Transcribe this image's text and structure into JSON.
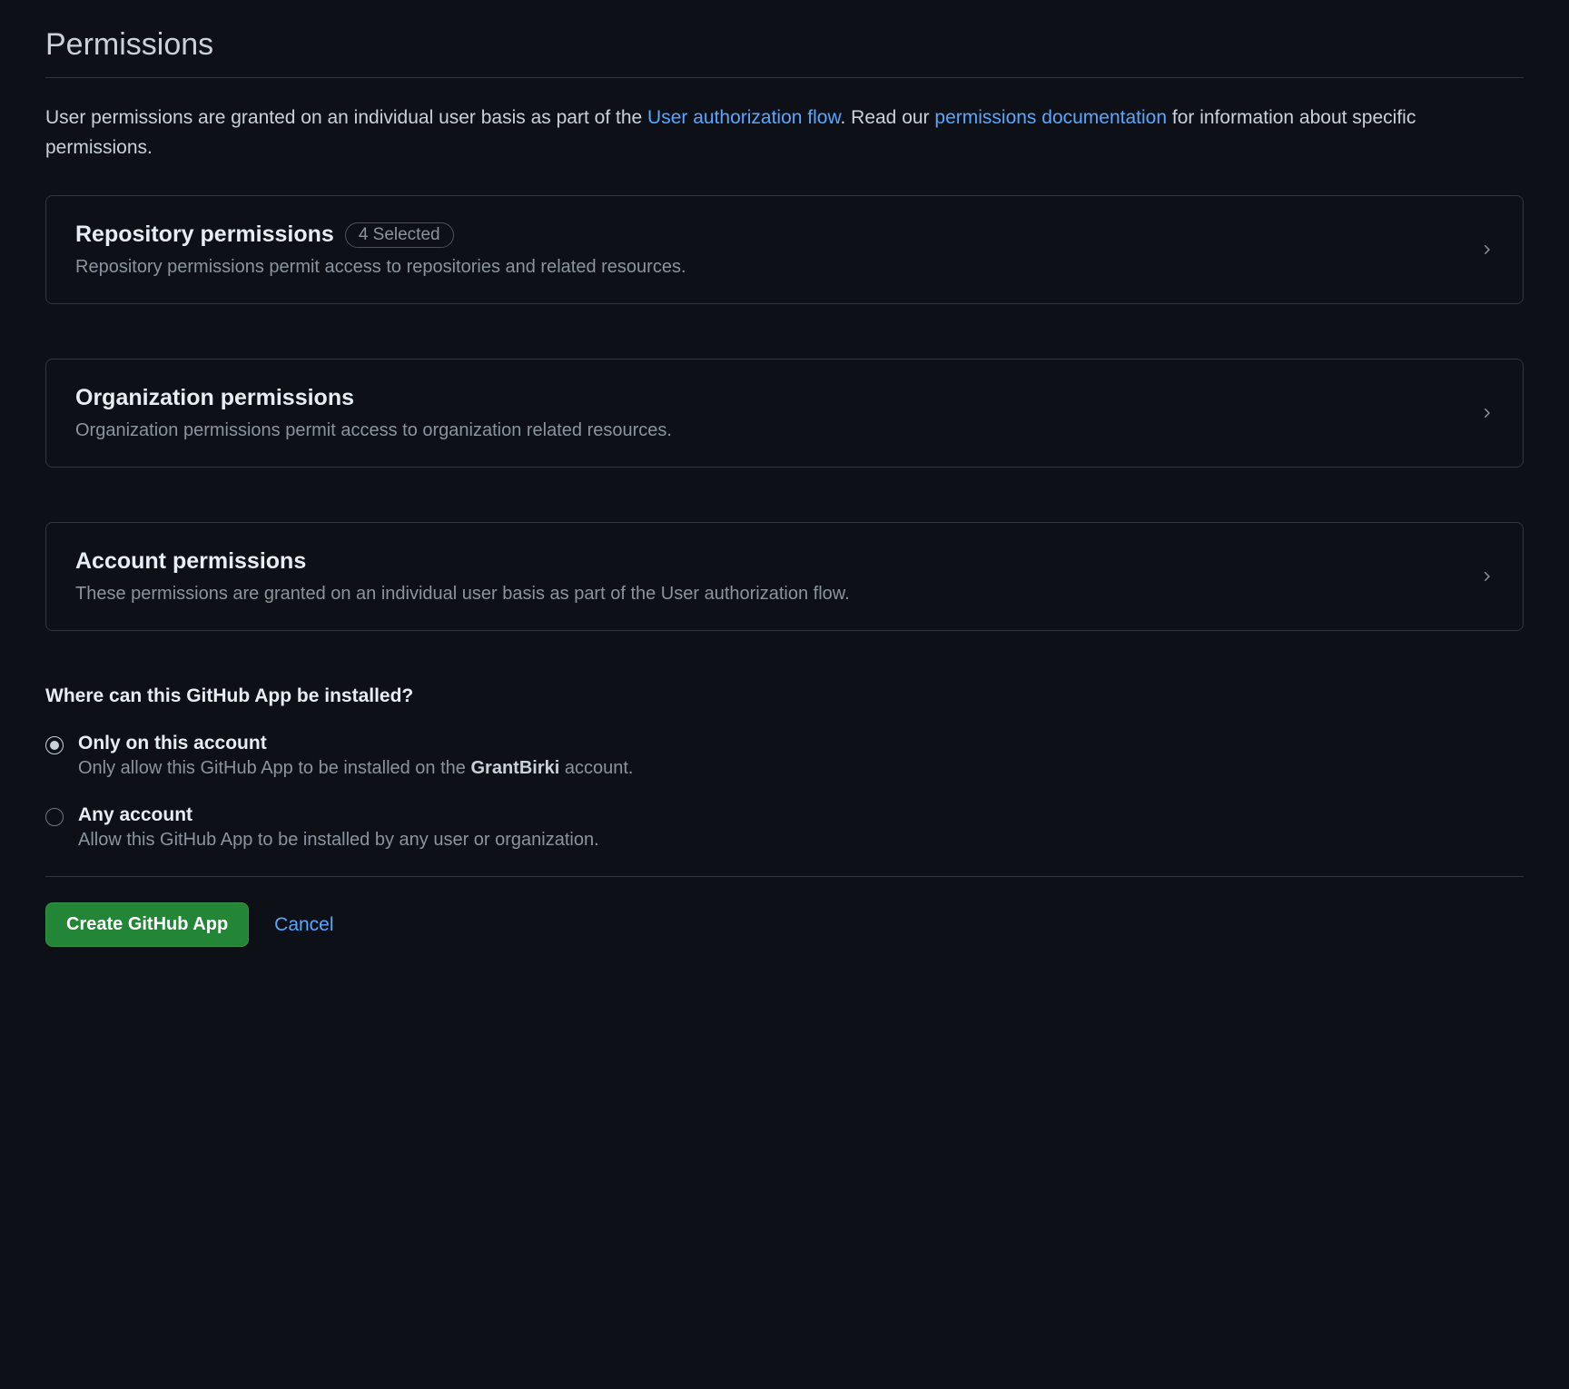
{
  "section": {
    "title": "Permissions",
    "intro_prefix": "User permissions are granted on an individual user basis as part of the ",
    "intro_link1": "User authorization flow",
    "intro_after_link1": ". Read our ",
    "intro_link2": "permissions documentation",
    "intro_suffix": " for information about specific permissions."
  },
  "cards": {
    "repository": {
      "title": "Repository permissions",
      "badge": "4 Selected",
      "desc": "Repository permissions permit access to repositories and related resources."
    },
    "organization": {
      "title": "Organization permissions",
      "desc": "Organization permissions permit access to organization related resources."
    },
    "account": {
      "title": "Account permissions",
      "desc": "These permissions are granted on an individual user basis as part of the User authorization flow."
    }
  },
  "install": {
    "title": "Where can this GitHub App be installed?",
    "only": {
      "label": "Only on this account",
      "desc_prefix": "Only allow this GitHub App to be installed on the ",
      "account": "GrantBirki",
      "desc_suffix": " account."
    },
    "any": {
      "label": "Any account",
      "desc": "Allow this GitHub App to be installed by any user or organization."
    }
  },
  "actions": {
    "create": "Create GitHub App",
    "cancel": "Cancel"
  }
}
